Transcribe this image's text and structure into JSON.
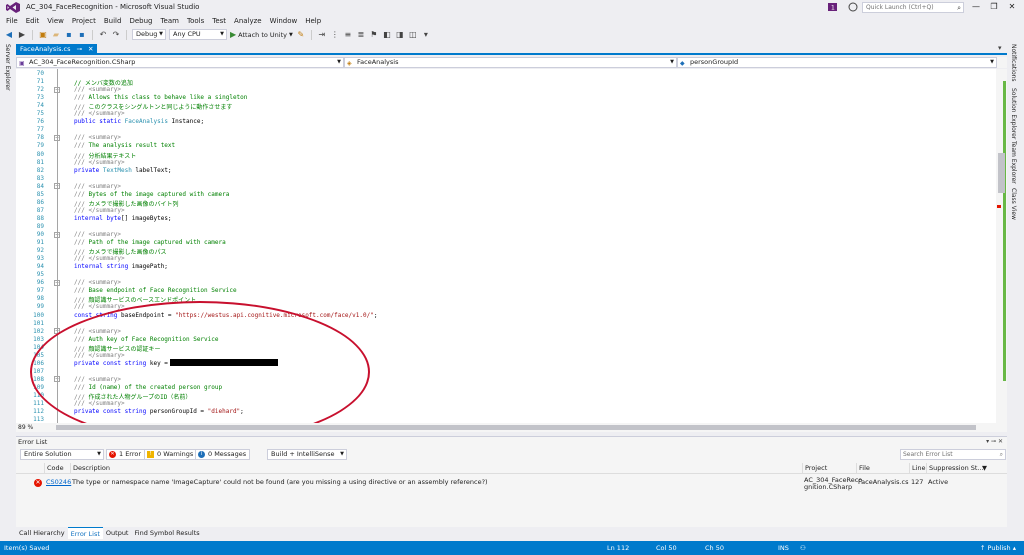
{
  "window": {
    "title": "AC_304_FaceRecognition - Microsoft Visual Studio",
    "quick_launch_placeholder": "Quick Launch (Ctrl+Q)",
    "minimize": "—",
    "maximize": "❐",
    "close": "✕",
    "notif_count": "1"
  },
  "menu": [
    "File",
    "Edit",
    "View",
    "Project",
    "Build",
    "Debug",
    "Team",
    "Tools",
    "Test",
    "Analyze",
    "Window",
    "Help"
  ],
  "toolbar": {
    "config": "Debug",
    "platform": "Any CPU",
    "attach": "Attach to Unity"
  },
  "side_tabs": {
    "left": "Server Explorer",
    "right": [
      "Notifications",
      "Solution Explorer",
      "Team Explorer",
      "Class View"
    ]
  },
  "document_tab": {
    "name": "FaceAnalysis.cs",
    "close": "✕",
    "pin": "⊸"
  },
  "navbar": {
    "project": "AC_304_FaceRecognition.CSharp",
    "class": "FaceAnalysis",
    "member": "personGroupId"
  },
  "editor": {
    "zoom": "89 %",
    "lines": [
      {
        "n": "70",
        "parts": []
      },
      {
        "n": "71",
        "parts": [
          {
            "c": "cm",
            "t": "// メンバ変数の追加"
          }
        ]
      },
      {
        "n": "72",
        "parts": [
          {
            "c": "cmg",
            "t": "/// <summary>"
          }
        ]
      },
      {
        "n": "73",
        "parts": [
          {
            "c": "cmg",
            "t": "/// "
          },
          {
            "c": "cm",
            "t": "Allows this class to behave like a singleton"
          }
        ]
      },
      {
        "n": "74",
        "parts": [
          {
            "c": "cmg",
            "t": "/// "
          },
          {
            "c": "cm",
            "t": "このクラスをシングルトンと同じように動作させます"
          }
        ]
      },
      {
        "n": "75",
        "parts": [
          {
            "c": "cmg",
            "t": "/// </summary>"
          }
        ]
      },
      {
        "n": "76",
        "parts": [
          {
            "c": "kw",
            "t": "public static "
          },
          {
            "c": "ty",
            "t": "FaceAnalysis"
          },
          {
            "c": "pl",
            "t": " Instance;"
          }
        ]
      },
      {
        "n": "77",
        "parts": []
      },
      {
        "n": "78",
        "parts": [
          {
            "c": "cmg",
            "t": "/// <summary>"
          }
        ]
      },
      {
        "n": "79",
        "parts": [
          {
            "c": "cmg",
            "t": "/// "
          },
          {
            "c": "cm",
            "t": "The analysis result text"
          }
        ]
      },
      {
        "n": "80",
        "parts": [
          {
            "c": "cmg",
            "t": "/// "
          },
          {
            "c": "cm",
            "t": "分析結果テキスト"
          }
        ]
      },
      {
        "n": "81",
        "parts": [
          {
            "c": "cmg",
            "t": "/// </summary>"
          }
        ]
      },
      {
        "n": "82",
        "parts": [
          {
            "c": "kw",
            "t": "private "
          },
          {
            "c": "ty",
            "t": "TextMesh"
          },
          {
            "c": "pl",
            "t": " labelText;"
          }
        ]
      },
      {
        "n": "83",
        "parts": []
      },
      {
        "n": "84",
        "parts": [
          {
            "c": "cmg",
            "t": "/// <summary>"
          }
        ]
      },
      {
        "n": "85",
        "parts": [
          {
            "c": "cmg",
            "t": "/// "
          },
          {
            "c": "cm",
            "t": "Bytes of the image captured with camera"
          }
        ]
      },
      {
        "n": "86",
        "parts": [
          {
            "c": "cmg",
            "t": "/// "
          },
          {
            "c": "cm",
            "t": "カメラで撮影した画像のバイト列"
          }
        ]
      },
      {
        "n": "87",
        "parts": [
          {
            "c": "cmg",
            "t": "/// </summary>"
          }
        ]
      },
      {
        "n": "88",
        "parts": [
          {
            "c": "kw",
            "t": "internal byte"
          },
          {
            "c": "pl",
            "t": "[] imageBytes;"
          }
        ]
      },
      {
        "n": "89",
        "parts": []
      },
      {
        "n": "90",
        "parts": [
          {
            "c": "cmg",
            "t": "/// <summary>"
          }
        ]
      },
      {
        "n": "91",
        "parts": [
          {
            "c": "cmg",
            "t": "/// "
          },
          {
            "c": "cm",
            "t": "Path of the image captured with camera"
          }
        ]
      },
      {
        "n": "92",
        "parts": [
          {
            "c": "cmg",
            "t": "/// "
          },
          {
            "c": "cm",
            "t": "カメラで撮影した画像のパス"
          }
        ]
      },
      {
        "n": "93",
        "parts": [
          {
            "c": "cmg",
            "t": "/// </summary>"
          }
        ]
      },
      {
        "n": "94",
        "parts": [
          {
            "c": "kw",
            "t": "internal string "
          },
          {
            "c": "pl",
            "t": "imagePath;"
          }
        ]
      },
      {
        "n": "95",
        "parts": []
      },
      {
        "n": "96",
        "parts": [
          {
            "c": "cmg",
            "t": "/// <summary>"
          }
        ]
      },
      {
        "n": "97",
        "parts": [
          {
            "c": "cmg",
            "t": "/// "
          },
          {
            "c": "cm",
            "t": "Base endpoint of Face Recognition Service"
          }
        ]
      },
      {
        "n": "98",
        "parts": [
          {
            "c": "cmg",
            "t": "/// "
          },
          {
            "c": "cm",
            "t": "顔認識サービスのベースエンドポイント"
          }
        ]
      },
      {
        "n": "99",
        "parts": [
          {
            "c": "cmg",
            "t": "/// </summary>"
          }
        ]
      },
      {
        "n": "100",
        "parts": [
          {
            "c": "kw",
            "t": "const string "
          },
          {
            "c": "pl",
            "t": "baseEndpoint = "
          },
          {
            "c": "str",
            "t": "\"https://westus.api.cognitive.microsoft.com/face/v1.0/\""
          },
          {
            "c": "pl",
            "t": ";"
          }
        ]
      },
      {
        "n": "101",
        "parts": []
      },
      {
        "n": "102",
        "parts": [
          {
            "c": "cmg",
            "t": "/// <summary>"
          }
        ]
      },
      {
        "n": "103",
        "parts": [
          {
            "c": "cmg",
            "t": "/// "
          },
          {
            "c": "cm",
            "t": "Auth key of Face Recognition Service"
          }
        ]
      },
      {
        "n": "104",
        "parts": [
          {
            "c": "cmg",
            "t": "/// "
          },
          {
            "c": "cm",
            "t": "顔認識サービスの認証キー"
          }
        ]
      },
      {
        "n": "105",
        "parts": [
          {
            "c": "cmg",
            "t": "/// </summary>"
          }
        ]
      },
      {
        "n": "106",
        "parts": [
          {
            "c": "kw",
            "t": "private const string "
          },
          {
            "c": "pl",
            "t": "key = "
          },
          {
            "c": "str",
            "t": "\"                          \""
          },
          {
            "c": "pl",
            "t": ";"
          }
        ]
      },
      {
        "n": "107",
        "parts": []
      },
      {
        "n": "108",
        "parts": [
          {
            "c": "cmg",
            "t": "/// <summary>"
          }
        ]
      },
      {
        "n": "109",
        "parts": [
          {
            "c": "cmg",
            "t": "/// "
          },
          {
            "c": "cm",
            "t": "Id (name) of the created person group"
          }
        ]
      },
      {
        "n": "110",
        "parts": [
          {
            "c": "cmg",
            "t": "/// "
          },
          {
            "c": "cm",
            "t": "作成された人物グループのID（名前）"
          }
        ]
      },
      {
        "n": "111",
        "parts": [
          {
            "c": "cmg",
            "t": "/// </summary>"
          }
        ]
      },
      {
        "n": "112",
        "parts": [
          {
            "c": "kw",
            "t": "private const string "
          },
          {
            "c": "pl",
            "t": "personGroupId = "
          },
          {
            "c": "str",
            "t": "\"diehard\""
          },
          {
            "c": "pl",
            "t": ";"
          }
        ]
      },
      {
        "n": "113",
        "parts": []
      }
    ]
  },
  "error_list": {
    "title": "Error List",
    "scope": "Entire Solution",
    "errors_btn": "1 Error",
    "warnings_btn": "0 Warnings",
    "messages_btn": "0 Messages",
    "build_filter": "Build + IntelliSense",
    "search_placeholder": "Search Error List",
    "columns": {
      "code": "Code",
      "description": "Description",
      "project": "Project",
      "file": "File",
      "line": "Line",
      "suppression": "Suppression St..."
    },
    "row": {
      "code": "CS0246",
      "description": "The type or namespace name 'ImageCapture' could not be found (are you missing a using directive or an assembly reference?)",
      "project": "AC_304_FaceReco gnition.CSharp",
      "file": "FaceAnalysis.cs",
      "line": "127",
      "suppression": "Active"
    }
  },
  "bottom_tabs": [
    "Call Hierarchy",
    "Error List",
    "Output",
    "Find Symbol Results"
  ],
  "status": {
    "message": "Item(s) Saved",
    "ln": "Ln 112",
    "col": "Col 50",
    "ch": "Ch 50",
    "ins": "INS",
    "publish": "↑ Publish ▴"
  },
  "colors": {
    "accent": "#007acc",
    "error": "#e51400",
    "annotation_ellipse": "#c8102e"
  }
}
